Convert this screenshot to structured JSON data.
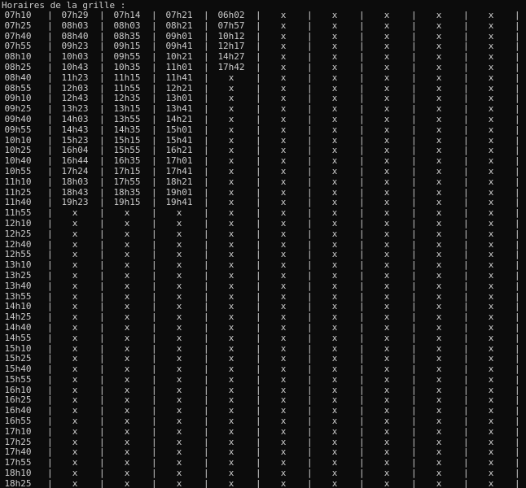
{
  "header": "Horaires de la grille :",
  "separator": "|",
  "rows": [
    [
      "07h10",
      "07h29",
      "07h14",
      "07h21",
      "06h02",
      "x",
      "x",
      "x",
      "x",
      "x"
    ],
    [
      "07h25",
      "08h03",
      "08h03",
      "08h21",
      "07h57",
      "x",
      "x",
      "x",
      "x",
      "x"
    ],
    [
      "07h40",
      "08h40",
      "08h35",
      "09h01",
      "10h12",
      "x",
      "x",
      "x",
      "x",
      "x"
    ],
    [
      "07h55",
      "09h23",
      "09h15",
      "09h41",
      "12h17",
      "x",
      "x",
      "x",
      "x",
      "x"
    ],
    [
      "08h10",
      "10h03",
      "09h55",
      "10h21",
      "14h27",
      "x",
      "x",
      "x",
      "x",
      "x"
    ],
    [
      "08h25",
      "10h43",
      "10h35",
      "11h01",
      "17h42",
      "x",
      "x",
      "x",
      "x",
      "x"
    ],
    [
      "08h40",
      "11h23",
      "11h15",
      "11h41",
      "x",
      "x",
      "x",
      "x",
      "x",
      "x"
    ],
    [
      "08h55",
      "12h03",
      "11h55",
      "12h21",
      "x",
      "x",
      "x",
      "x",
      "x",
      "x"
    ],
    [
      "09h10",
      "12h43",
      "12h35",
      "13h01",
      "x",
      "x",
      "x",
      "x",
      "x",
      "x"
    ],
    [
      "09h25",
      "13h23",
      "13h15",
      "13h41",
      "x",
      "x",
      "x",
      "x",
      "x",
      "x"
    ],
    [
      "09h40",
      "14h03",
      "13h55",
      "14h21",
      "x",
      "x",
      "x",
      "x",
      "x",
      "x"
    ],
    [
      "09h55",
      "14h43",
      "14h35",
      "15h01",
      "x",
      "x",
      "x",
      "x",
      "x",
      "x"
    ],
    [
      "10h10",
      "15h23",
      "15h15",
      "15h41",
      "x",
      "x",
      "x",
      "x",
      "x",
      "x"
    ],
    [
      "10h25",
      "16h04",
      "15h55",
      "16h21",
      "x",
      "x",
      "x",
      "x",
      "x",
      "x"
    ],
    [
      "10h40",
      "16h44",
      "16h35",
      "17h01",
      "x",
      "x",
      "x",
      "x",
      "x",
      "x"
    ],
    [
      "10h55",
      "17h24",
      "17h15",
      "17h41",
      "x",
      "x",
      "x",
      "x",
      "x",
      "x"
    ],
    [
      "11h10",
      "18h03",
      "17h55",
      "18h21",
      "x",
      "x",
      "x",
      "x",
      "x",
      "x"
    ],
    [
      "11h25",
      "18h43",
      "18h35",
      "19h01",
      "x",
      "x",
      "x",
      "x",
      "x",
      "x"
    ],
    [
      "11h40",
      "19h23",
      "19h15",
      "19h41",
      "x",
      "x",
      "x",
      "x",
      "x",
      "x"
    ],
    [
      "11h55",
      "x",
      "x",
      "x",
      "x",
      "x",
      "x",
      "x",
      "x",
      "x"
    ],
    [
      "12h10",
      "x",
      "x",
      "x",
      "x",
      "x",
      "x",
      "x",
      "x",
      "x"
    ],
    [
      "12h25",
      "x",
      "x",
      "x",
      "x",
      "x",
      "x",
      "x",
      "x",
      "x"
    ],
    [
      "12h40",
      "x",
      "x",
      "x",
      "x",
      "x",
      "x",
      "x",
      "x",
      "x"
    ],
    [
      "12h55",
      "x",
      "x",
      "x",
      "x",
      "x",
      "x",
      "x",
      "x",
      "x"
    ],
    [
      "13h10",
      "x",
      "x",
      "x",
      "x",
      "x",
      "x",
      "x",
      "x",
      "x"
    ],
    [
      "13h25",
      "x",
      "x",
      "x",
      "x",
      "x",
      "x",
      "x",
      "x",
      "x"
    ],
    [
      "13h40",
      "x",
      "x",
      "x",
      "x",
      "x",
      "x",
      "x",
      "x",
      "x"
    ],
    [
      "13h55",
      "x",
      "x",
      "x",
      "x",
      "x",
      "x",
      "x",
      "x",
      "x"
    ],
    [
      "14h10",
      "x",
      "x",
      "x",
      "x",
      "x",
      "x",
      "x",
      "x",
      "x"
    ],
    [
      "14h25",
      "x",
      "x",
      "x",
      "x",
      "x",
      "x",
      "x",
      "x",
      "x"
    ],
    [
      "14h40",
      "x",
      "x",
      "x",
      "x",
      "x",
      "x",
      "x",
      "x",
      "x"
    ],
    [
      "14h55",
      "x",
      "x",
      "x",
      "x",
      "x",
      "x",
      "x",
      "x",
      "x"
    ],
    [
      "15h10",
      "x",
      "x",
      "x",
      "x",
      "x",
      "x",
      "x",
      "x",
      "x"
    ],
    [
      "15h25",
      "x",
      "x",
      "x",
      "x",
      "x",
      "x",
      "x",
      "x",
      "x"
    ],
    [
      "15h40",
      "x",
      "x",
      "x",
      "x",
      "x",
      "x",
      "x",
      "x",
      "x"
    ],
    [
      "15h55",
      "x",
      "x",
      "x",
      "x",
      "x",
      "x",
      "x",
      "x",
      "x"
    ],
    [
      "16h10",
      "x",
      "x",
      "x",
      "x",
      "x",
      "x",
      "x",
      "x",
      "x"
    ],
    [
      "16h25",
      "x",
      "x",
      "x",
      "x",
      "x",
      "x",
      "x",
      "x",
      "x"
    ],
    [
      "16h40",
      "x",
      "x",
      "x",
      "x",
      "x",
      "x",
      "x",
      "x",
      "x"
    ],
    [
      "16h55",
      "x",
      "x",
      "x",
      "x",
      "x",
      "x",
      "x",
      "x",
      "x"
    ],
    [
      "17h10",
      "x",
      "x",
      "x",
      "x",
      "x",
      "x",
      "x",
      "x",
      "x"
    ],
    [
      "17h25",
      "x",
      "x",
      "x",
      "x",
      "x",
      "x",
      "x",
      "x",
      "x"
    ],
    [
      "17h40",
      "x",
      "x",
      "x",
      "x",
      "x",
      "x",
      "x",
      "x",
      "x"
    ],
    [
      "17h55",
      "x",
      "x",
      "x",
      "x",
      "x",
      "x",
      "x",
      "x",
      "x"
    ],
    [
      "18h10",
      "x",
      "x",
      "x",
      "x",
      "x",
      "x",
      "x",
      "x",
      "x"
    ],
    [
      "18h25",
      "x",
      "x",
      "x",
      "x",
      "x",
      "x",
      "x",
      "x",
      "x"
    ]
  ]
}
